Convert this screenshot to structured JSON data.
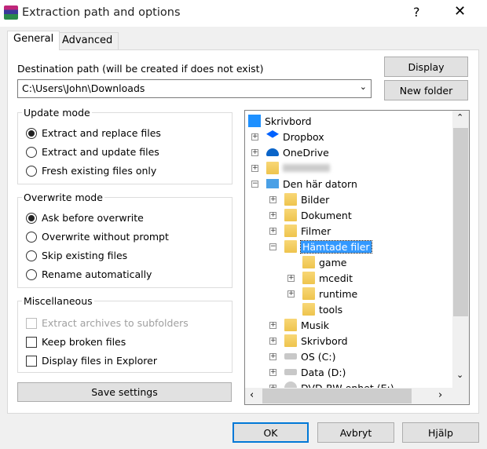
{
  "window": {
    "title": "Extraction path and options",
    "help": "?",
    "close": "✕"
  },
  "tabs": [
    {
      "label": "General",
      "active": true
    },
    {
      "label": "Advanced",
      "active": false
    }
  ],
  "destination": {
    "label": "Destination path (will be created if does not exist)",
    "value": "C:\\Users\\John\\Downloads"
  },
  "buttons": {
    "display": "Display",
    "new_folder": "New folder",
    "save_settings": "Save settings",
    "ok": "OK",
    "cancel": "Avbryt",
    "help": "Hjälp"
  },
  "update_mode": {
    "title": "Update mode",
    "options": [
      {
        "label": "Extract and replace files",
        "selected": true
      },
      {
        "label": "Extract and update files",
        "selected": false
      },
      {
        "label": "Fresh existing files only",
        "selected": false
      }
    ]
  },
  "overwrite_mode": {
    "title": "Overwrite mode",
    "options": [
      {
        "label": "Ask before overwrite",
        "selected": true
      },
      {
        "label": "Overwrite without prompt",
        "selected": false
      },
      {
        "label": "Skip existing files",
        "selected": false
      },
      {
        "label": "Rename automatically",
        "selected": false
      }
    ]
  },
  "misc": {
    "title": "Miscellaneous",
    "options": [
      {
        "label": "Extract archives to subfolders",
        "checked": false,
        "disabled": true
      },
      {
        "label": "Keep broken files",
        "checked": false,
        "disabled": false
      },
      {
        "label": "Display files in Explorer",
        "checked": false,
        "disabled": false
      }
    ]
  },
  "tree": [
    {
      "label": "Skrivbord",
      "level": 0,
      "icon": "desktop-icon",
      "exp": ""
    },
    {
      "label": "Dropbox",
      "level": 1,
      "icon": "dropbox-icon",
      "exp": "+"
    },
    {
      "label": "OneDrive",
      "level": 1,
      "icon": "onedrive-icon",
      "exp": "+"
    },
    {
      "label": "",
      "level": 1,
      "icon": "user-folder-icon",
      "exp": "+",
      "blurred": true
    },
    {
      "label": "Den här datorn",
      "level": 1,
      "icon": "computer-icon",
      "exp": "−"
    },
    {
      "label": "Bilder",
      "level": 2,
      "icon": "pictures-folder-icon",
      "exp": "+"
    },
    {
      "label": "Dokument",
      "level": 2,
      "icon": "documents-folder-icon",
      "exp": "+"
    },
    {
      "label": "Filmer",
      "level": 2,
      "icon": "videos-folder-icon",
      "exp": "+"
    },
    {
      "label": "Hämtade filer",
      "level": 2,
      "icon": "downloads-folder-icon",
      "exp": "−",
      "selected": true
    },
    {
      "label": "game",
      "level": 3,
      "icon": "folder-icon",
      "exp": ""
    },
    {
      "label": "mcedit",
      "level": 3,
      "icon": "folder-icon",
      "exp": "+"
    },
    {
      "label": "runtime",
      "level": 3,
      "icon": "folder-icon",
      "exp": "+"
    },
    {
      "label": "tools",
      "level": 3,
      "icon": "folder-icon",
      "exp": ""
    },
    {
      "label": "Musik",
      "level": 2,
      "icon": "music-folder-icon",
      "exp": "+"
    },
    {
      "label": "Skrivbord",
      "level": 2,
      "icon": "desktop-folder-icon",
      "exp": "+"
    },
    {
      "label": "OS (C:)",
      "level": 2,
      "icon": "drive-icon",
      "exp": "+"
    },
    {
      "label": "Data (D:)",
      "level": 2,
      "icon": "drive-icon",
      "exp": "+"
    },
    {
      "label": "DVD-RW-enhet (E:)",
      "level": 2,
      "icon": "dvd-drive-icon",
      "exp": "+"
    }
  ],
  "colors": {
    "selection": "#3399ff",
    "button": "#e1e1e1",
    "default_button_border": "#0078d7"
  }
}
